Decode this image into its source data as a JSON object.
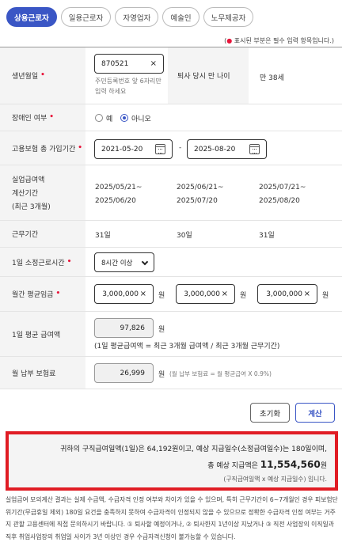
{
  "tabs": [
    {
      "label": "상용근로자",
      "active": true
    },
    {
      "label": "일용근로자",
      "active": false
    },
    {
      "label": "자영업자",
      "active": false
    },
    {
      "label": "예술인",
      "active": false
    },
    {
      "label": "노무제공자",
      "active": false
    }
  ],
  "note": {
    "prefix": "(",
    "dot": "●",
    "text": " 표시된 부분은 필수 입력 항목입니다.)"
  },
  "birth": {
    "label": "생년월일",
    "value": "870521",
    "clear": "×",
    "hint_line1": "주민등록번호 앞 6자리만",
    "hint_line2": "입력 하세요",
    "age_label": "퇴사 당시 만 나이",
    "age_value": "만 38세"
  },
  "disability": {
    "label": "장애인 여부",
    "yes": "예",
    "no": "아니오",
    "selected": "아니오"
  },
  "insurance_period": {
    "label": "고용보험 총 가입기간",
    "start": "2021-05-20",
    "separator": "-",
    "end": "2025-08-20"
  },
  "calc_period": {
    "label_line1": "실업급여액",
    "label_line2": "계산기간",
    "label_line3": "(최근 3개월)",
    "periods": [
      {
        "from": "2025/05/21~",
        "to": "2025/06/20"
      },
      {
        "from": "2025/06/21~",
        "to": "2025/07/20"
      },
      {
        "from": "2025/07/21~",
        "to": "2025/08/20"
      }
    ]
  },
  "work_days": {
    "label": "근무기간",
    "values": [
      "31일",
      "30일",
      "31일"
    ]
  },
  "daily_hours": {
    "label": "1일 소정근로시간",
    "selected": "8시간 이상"
  },
  "monthly_wage": {
    "label": "월간 평균임금",
    "unit": "원",
    "clear": "×",
    "values": [
      "3,000,000",
      "3,000,000",
      "3,000,000"
    ]
  },
  "daily_wage": {
    "label": "1일 평균 급여액",
    "value": "97,826",
    "unit": "원",
    "formula": "(1일 평균급여액 = 최근 3개월 급여액 / 최근 3개월 근무기간)"
  },
  "monthly_premium": {
    "label": "월 납부 보험료",
    "value": "26,999",
    "unit": "원",
    "formula": "(월 납부 보험료 = 월 평균급여 X 0.9%)"
  },
  "buttons": {
    "reset": "초기화",
    "calculate": "계산"
  },
  "result": {
    "line1": "귀하의 구직급여일액(1일)은 64,192원이고, 예상 지급일수(소정급여일수)는 180일이며,",
    "line2_prefix": "총 예상 지급액은 ",
    "total": "11,554,560",
    "line2_suffix": "원",
    "line3": "(구직급여일액 x 예상 지급일수) 입니다."
  },
  "disclaimer": "실업급여 모의계산 결과는 실제 수급액, 수급자격 인정 여부와 차이가 있을 수 있으며, 특히 근무기간이 6~7개월인 경우 피보험단위기간(무급휴일 제외) 180일 요건을 충족하지 못하여 수급자격이 인정되지 않을 수 있으므로 정확한 수급자격 인정 여부는 거주지 관할 고용센터에 직접 문의하시기 바랍니다. ① 퇴사할 예정이거나, ② 퇴사한지 1년이상 지났거나 ③ 직전 사업장의 이직일과 직후 취업사업장의 취업일 사이가 3년 이상인 경우 수급자격신청이 불가능할 수 있습니다."
}
